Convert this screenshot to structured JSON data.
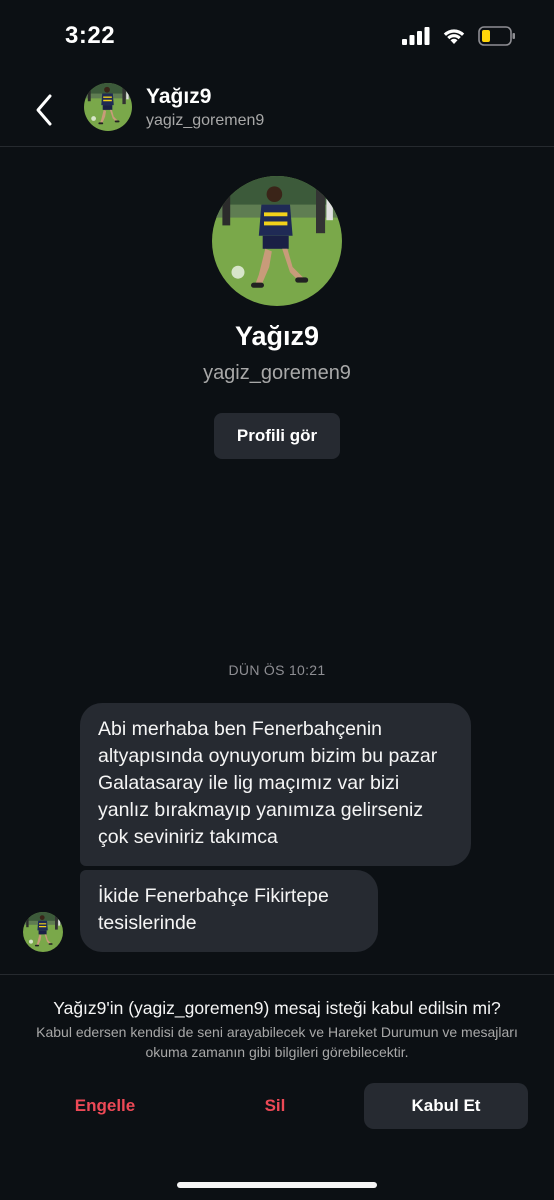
{
  "status_bar": {
    "time": "3:22"
  },
  "header": {
    "display_name": "Yağız9",
    "username": "yagiz_goremen9"
  },
  "profile": {
    "display_name": "Yağız9",
    "username": "yagiz_goremen9",
    "view_profile_label": "Profili gör"
  },
  "conversation": {
    "timestamp": "DÜN ÖS 10:21",
    "messages": [
      {
        "text": "Abi merhaba ben Fenerbahçenin altyapısında oynuyorum bizim bu pazar Galatasaray ile lig maçımız var bizi yanlız bırakmayıp yanımıza gelirseniz çok seviniriz takımca"
      },
      {
        "text": "İkide Fenerbahçe Fikirtepe tesislerinde"
      }
    ]
  },
  "request": {
    "title": "Yağız9'in (yagiz_goremen9) mesaj isteği kabul edilsin mi?",
    "description": "Kabul edersen kendisi de seni arayabilecek ve Hareket Durumun ve mesajları okuma zamanın gibi bilgileri görebilecektir.",
    "block_label": "Engelle",
    "delete_label": "Sil",
    "accept_label": "Kabul Et"
  },
  "colors": {
    "background": "#0c1014",
    "bubble": "#262a31",
    "danger": "#ed4956",
    "battery": "#ffd60a"
  },
  "icons": {
    "back": "chevron-left-icon",
    "signal": "signal-icon",
    "wifi": "wifi-icon",
    "battery": "battery-low-icon"
  }
}
